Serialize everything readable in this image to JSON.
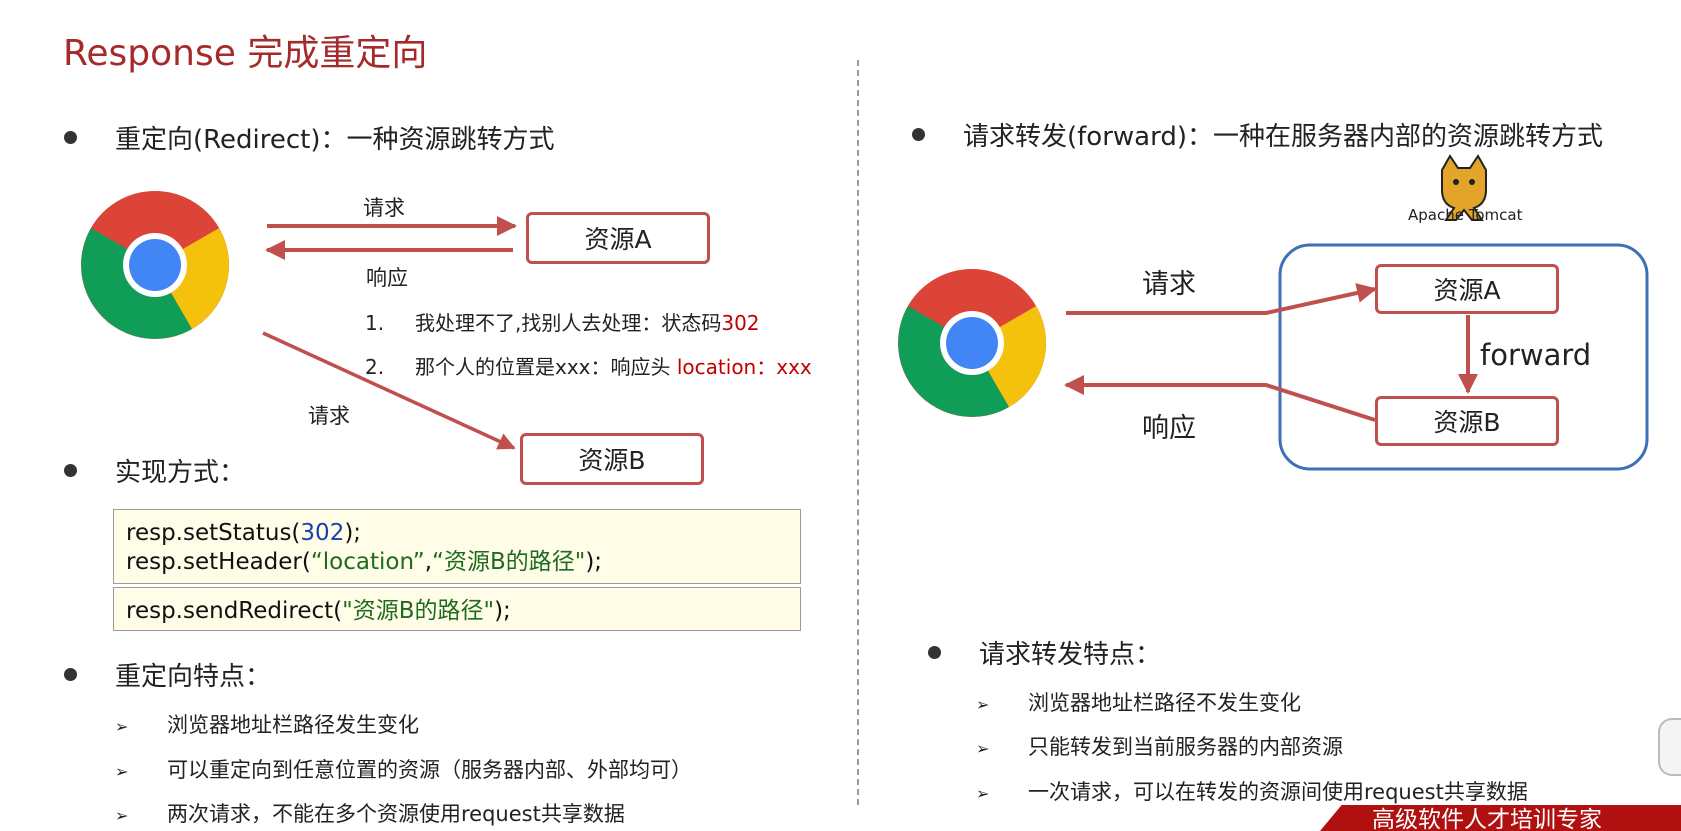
{
  "title": "Response 完成重定向",
  "left": {
    "bullet_redirect": "重定向(Redirect)：一种资源跳转方式",
    "request_label_top": "请求",
    "response_label": "响应",
    "resource_a": "资源A",
    "resource_b": "资源B",
    "request_label_bottom": "请求",
    "notes": [
      {
        "num": "1.",
        "text": "我处理不了,找别人去处理：状态码",
        "highlight": "302"
      },
      {
        "num": "2.",
        "text": "那个人的位置是xxx：响应头 ",
        "highlight": "location：xxx"
      }
    ],
    "bullet_impl": "实现方式：",
    "code1": {
      "line1_pre": "resp.setStatus(",
      "line1_num": "302",
      "line1_post": ");",
      "line2_pre": "resp.setHeader(",
      "line2_str1": "“location”",
      "line2_sep": ",",
      "line2_str2": "“资源B的路径\"",
      "line2_post": ");"
    },
    "code2": {
      "pre": "resp.sendRedirect(",
      "str": "\"资源B的路径\"",
      "post": ");"
    },
    "bullet_features": "重定向特点：",
    "features": [
      "浏览器地址栏路径发生变化",
      "可以重定向到任意位置的资源（服务器内部、外部均可）",
      "两次请求，不能在多个资源使用request共享数据"
    ]
  },
  "right": {
    "bullet_forward": "请求转发(forward)：一种在服务器内部的资源跳转方式",
    "tomcat_label": "Apache Tomcat",
    "request_label": "请求",
    "response_label": "响应",
    "resource_a": "资源A",
    "resource_b": "资源B",
    "forward_label": "forward",
    "bullet_features": "请求转发特点：",
    "features": [
      "浏览器地址栏路径不发生变化",
      "只能转发到当前服务器的内部资源",
      "一次请求，可以在转发的资源间使用request共享数据"
    ]
  },
  "footer_text": "高级软件人才培训专家",
  "colors": {
    "title": "#a52a2a",
    "arrow": "#c0504d",
    "container_border": "#3f6fb5",
    "code_bg": "#fffde8",
    "highlight_red": "#c00000",
    "footer_bg": "#b01010"
  },
  "icons": [
    "chrome-logo-icon",
    "tomcat-logo-icon",
    "bullet-icon",
    "arrow-bullet-icon"
  ]
}
